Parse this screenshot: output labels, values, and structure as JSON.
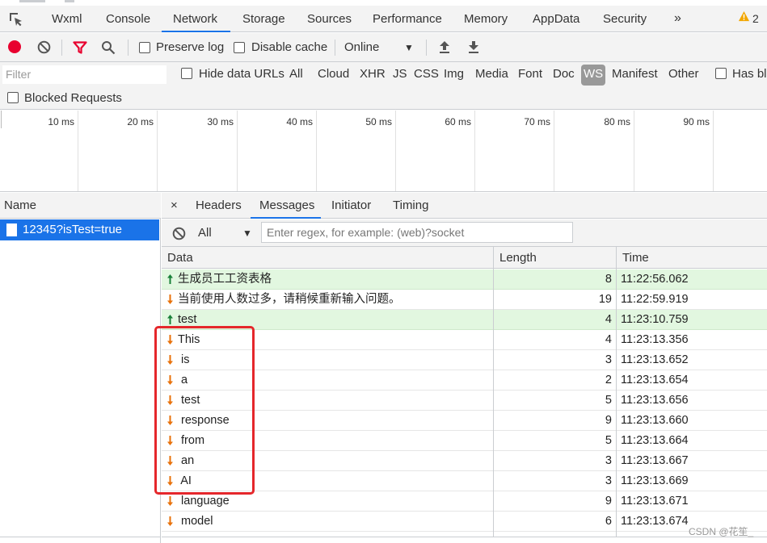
{
  "tabs": {
    "items": [
      "Wxml",
      "Console",
      "Network",
      "Storage",
      "Sources",
      "Performance",
      "Memory",
      "AppData",
      "Security"
    ],
    "active": "Network",
    "more": "»",
    "warning_count": "2"
  },
  "toolbar": {
    "preserve_log": "Preserve log",
    "disable_cache": "Disable cache",
    "throttling": "Online"
  },
  "filter": {
    "placeholder": "Filter",
    "hide_data_urls": "Hide data URLs",
    "types": [
      "All",
      "Cloud",
      "XHR",
      "JS",
      "CSS",
      "Img",
      "Media",
      "Font",
      "Doc",
      "WS",
      "Manifest",
      "Other"
    ],
    "active_type": "WS",
    "has_blocked": "Has blo",
    "blocked_requests": "Blocked Requests"
  },
  "overview": {
    "ticks": [
      "10 ms",
      "20 ms",
      "30 ms",
      "40 ms",
      "50 ms",
      "60 ms",
      "70 ms",
      "80 ms",
      "90 ms",
      "10"
    ]
  },
  "requests": {
    "header": "Name",
    "selected": "12345?isTest=true"
  },
  "detail": {
    "close": "×",
    "tabs": [
      "Headers",
      "Messages",
      "Initiator",
      "Timing"
    ],
    "active_tab": "Messages",
    "filter_all": "All",
    "regex_placeholder": "Enter regex, for example: (web)?socket",
    "columns": {
      "data": "Data",
      "length": "Length",
      "time": "Time"
    },
    "messages": [
      {
        "dir": "sent",
        "data": "生成员工工资表格",
        "length": "8",
        "time": "11:22:56.062"
      },
      {
        "dir": "recv",
        "data": "当前使用人数过多，请稍候重新输入问题。",
        "length": "19",
        "time": "11:22:59.919"
      },
      {
        "dir": "sent",
        "data": "test",
        "length": "4",
        "time": "11:23:10.759"
      },
      {
        "dir": "recv",
        "data": "This",
        "length": "4",
        "time": "11:23:13.356"
      },
      {
        "dir": "recv",
        "data": " is",
        "length": "3",
        "time": "11:23:13.652"
      },
      {
        "dir": "recv",
        "data": " a",
        "length": "2",
        "time": "11:23:13.654"
      },
      {
        "dir": "recv",
        "data": " test",
        "length": "5",
        "time": "11:23:13.656"
      },
      {
        "dir": "recv",
        "data": " response",
        "length": "9",
        "time": "11:23:13.660"
      },
      {
        "dir": "recv",
        "data": " from",
        "length": "5",
        "time": "11:23:13.664"
      },
      {
        "dir": "recv",
        "data": " an",
        "length": "3",
        "time": "11:23:13.667"
      },
      {
        "dir": "recv",
        "data": " AI",
        "length": "3",
        "time": "11:23:13.669"
      },
      {
        "dir": "recv",
        "data": " language",
        "length": "9",
        "time": "11:23:13.671"
      },
      {
        "dir": "recv",
        "data": " model",
        "length": "6",
        "time": "11:23:13.674"
      }
    ]
  },
  "watermark": "CSDN @花笙_",
  "colors": {
    "accent": "#1a73e8",
    "record": "#e8002f",
    "sent_row": "#e2f7e0",
    "highlight": "#e5272b"
  }
}
